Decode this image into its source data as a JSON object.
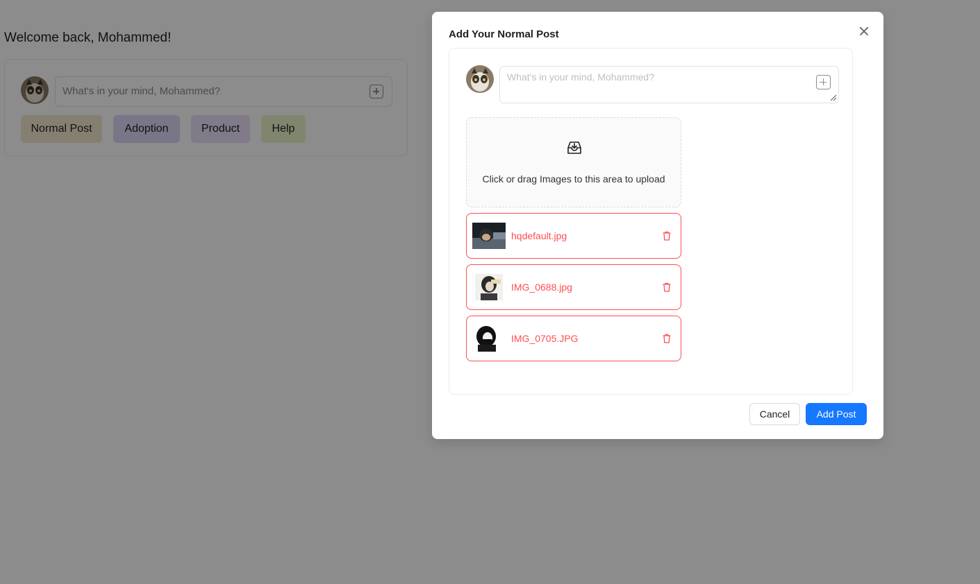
{
  "page": {
    "welcome": "Welcome back, Mohammed!",
    "composer": {
      "placeholder": "What's in your mind, Mohammed?",
      "add_icon": "plus-square-icon"
    },
    "post_types": [
      {
        "label": "Normal Post",
        "color": "#f3e8cf"
      },
      {
        "label": "Adoption",
        "color": "#ddd8f6"
      },
      {
        "label": "Product",
        "color": "#e9defa"
      },
      {
        "label": "Help",
        "color": "#eaf3c9"
      }
    ]
  },
  "modal": {
    "title": "Add Your Normal Post",
    "close_icon": "close-icon",
    "textarea_placeholder": "What's in your mind, Mohammed?",
    "upload": {
      "icon": "inbox-icon",
      "text": "Click or drag Images to this area to upload"
    },
    "files": [
      {
        "name": "hqdefault.jpg",
        "status_color": "#ff4d4f"
      },
      {
        "name": "IMG_0688.jpg",
        "status_color": "#ff4d4f"
      },
      {
        "name": "IMG_0705.JPG",
        "status_color": "#ff4d4f"
      }
    ],
    "cancel_label": "Cancel",
    "submit_label": "Add Post",
    "primary_color": "#1677ff"
  }
}
